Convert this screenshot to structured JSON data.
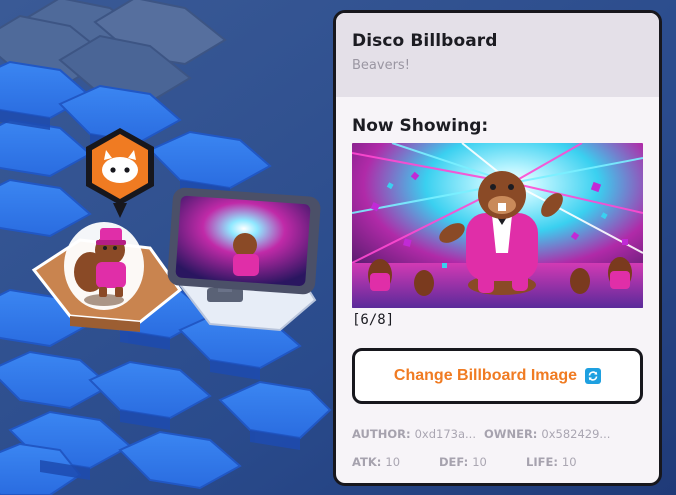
{
  "panel": {
    "title": "Disco Billboard",
    "subtitle": "Beavers!",
    "now_showing_label": "Now Showing:",
    "image_counter": "[6/8]",
    "change_button_label": "Change Billboard Image",
    "stats": {
      "author_key": "AUTHOR:",
      "author_value": "0xd173a...",
      "owner_key": "OWNER:",
      "owner_value": "0x582429...",
      "atk_key": "ATK:",
      "atk_value": "10",
      "def_key": "DEF:",
      "def_value": "10",
      "life_key": "LIFE:",
      "life_value": "10"
    }
  },
  "icons": {
    "map_pin": "bot-face-icon",
    "change_button": "refresh-icon"
  },
  "colors": {
    "accent_orange": "#f07b22",
    "refresh_blue": "#1ea0e0",
    "hex_tile_blue": "#2e6fe0",
    "selected_tile": "#c9844f",
    "billboard_magenta": "#e02ea8"
  }
}
